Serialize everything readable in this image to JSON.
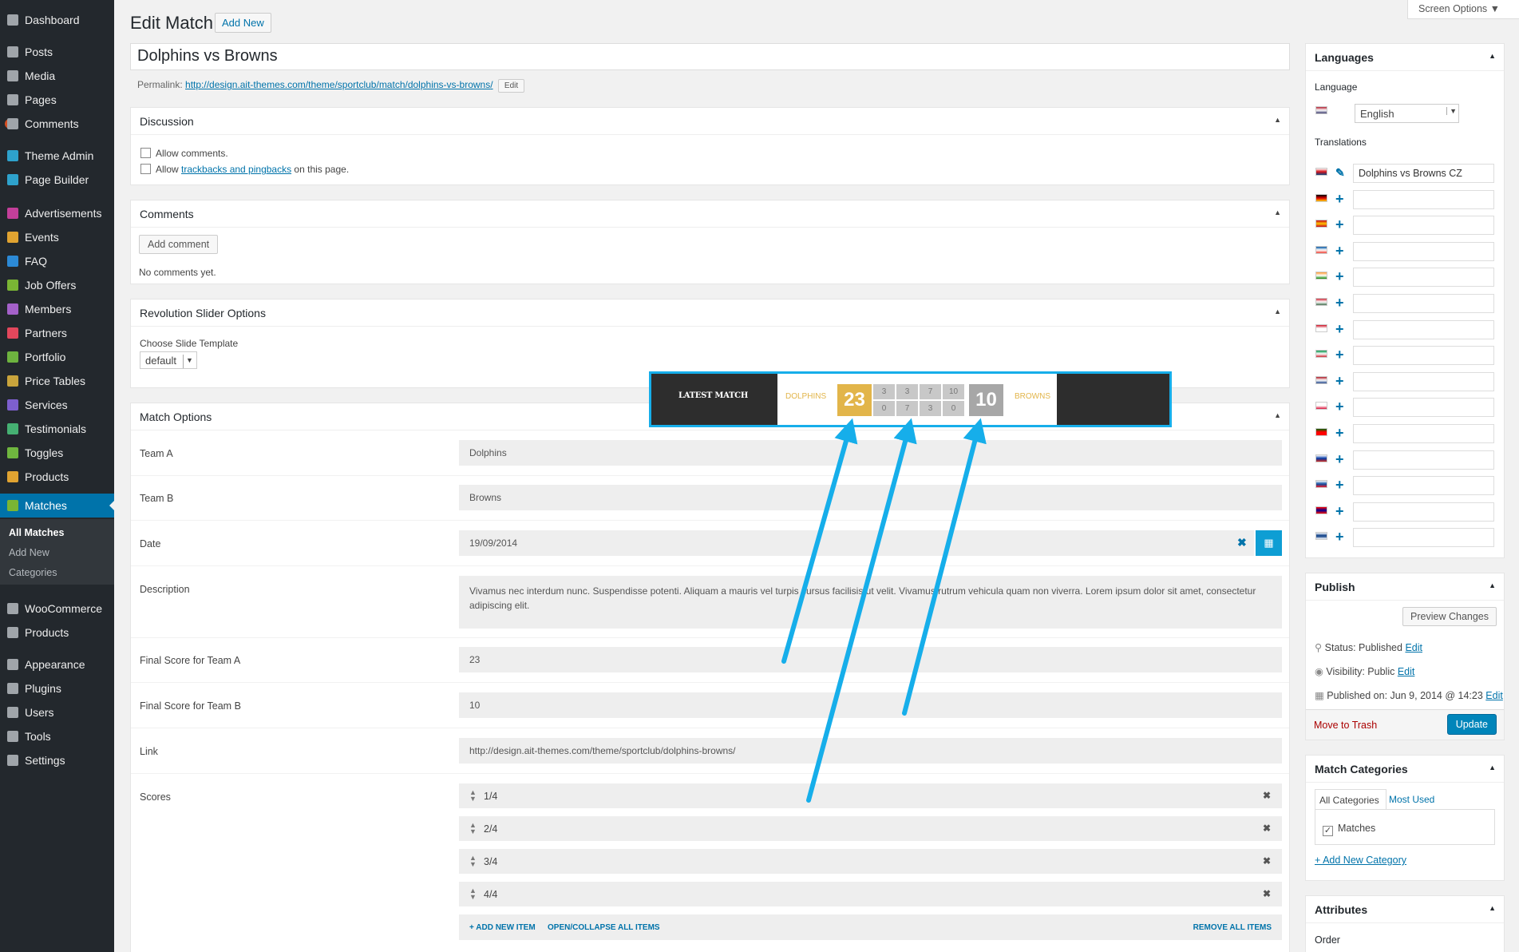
{
  "sidebar": {
    "items": [
      {
        "label": "Dashboard",
        "icon": "dashboard-icon",
        "color": "#a0a5aa"
      },
      {
        "label": "Posts",
        "icon": "pin-icon",
        "color": "#a0a5aa"
      },
      {
        "label": "Media",
        "icon": "media-icon",
        "color": "#a0a5aa"
      },
      {
        "label": "Pages",
        "icon": "pages-icon",
        "color": "#a0a5aa"
      },
      {
        "label": "Comments",
        "icon": "comment-icon",
        "color": "#a0a5aa",
        "badge": "2"
      },
      {
        "label": "Theme Admin",
        "icon": "theme-admin-icon",
        "color": "#2ea2cc"
      },
      {
        "label": "Page Builder",
        "icon": "page-builder-icon",
        "color": "#2ea2cc"
      },
      {
        "label": "Advertisements",
        "icon": "advertisements-icon",
        "color": "#c33f9a"
      },
      {
        "label": "Events",
        "icon": "events-icon",
        "color": "#e0a331"
      },
      {
        "label": "FAQ",
        "icon": "faq-icon",
        "color": "#2c8ad6"
      },
      {
        "label": "Job Offers",
        "icon": "job-offers-icon",
        "color": "#7ab534"
      },
      {
        "label": "Members",
        "icon": "members-icon",
        "color": "#a461c9"
      },
      {
        "label": "Partners",
        "icon": "partners-icon",
        "color": "#e2475c"
      },
      {
        "label": "Portfolio",
        "icon": "portfolio-icon",
        "color": "#6db33f"
      },
      {
        "label": "Price Tables",
        "icon": "price-tables-icon",
        "color": "#c9a43c"
      },
      {
        "label": "Services",
        "icon": "services-icon",
        "color": "#7d5fce"
      },
      {
        "label": "Testimonials",
        "icon": "testimonials-icon",
        "color": "#45b072"
      },
      {
        "label": "Toggles",
        "icon": "toggles-icon",
        "color": "#6fb63f"
      },
      {
        "label": "Products",
        "icon": "products-icon",
        "color": "#e0a331"
      },
      {
        "label": "Matches",
        "icon": "matches-icon",
        "color": "#7ab534",
        "current": true
      },
      {
        "label": "WooCommerce",
        "icon": "woocommerce-icon",
        "color": "#a0a5aa"
      },
      {
        "label": "Products",
        "icon": "box-icon",
        "color": "#a0a5aa"
      },
      {
        "label": "Appearance",
        "icon": "appearance-icon",
        "color": "#a0a5aa"
      },
      {
        "label": "Plugins",
        "icon": "plugins-icon",
        "color": "#a0a5aa"
      },
      {
        "label": "Users",
        "icon": "users-icon",
        "color": "#a0a5aa"
      },
      {
        "label": "Tools",
        "icon": "tools-icon",
        "color": "#a0a5aa"
      },
      {
        "label": "Settings",
        "icon": "settings-icon",
        "color": "#a0a5aa"
      }
    ],
    "submenu": [
      "All Matches",
      "Add New",
      "Categories"
    ]
  },
  "header": {
    "title": "Edit Match",
    "add_new": "Add New",
    "screen_options": "Screen Options ▼"
  },
  "post": {
    "title": "Dolphins vs Browns",
    "permalink_label": "Permalink:",
    "permalink_base": "http://design.ait-themes.com/theme/sportclub/match/",
    "permalink_slug": "dolphins-vs-browns",
    "permalink_trail": "/",
    "edit": "Edit"
  },
  "discussion": {
    "title": "Discussion",
    "allow_comments": "Allow comments.",
    "allow_pre": "Allow ",
    "allow_link": "trackbacks and pingbacks",
    "allow_post": " on this page."
  },
  "comments": {
    "title": "Comments",
    "add": "Add comment",
    "none": "No comments yet."
  },
  "slider": {
    "title": "Revolution Slider Options",
    "choose": "Choose Slide Template",
    "value": "default"
  },
  "match": {
    "title": "Match Options",
    "team_a_label": "Team A",
    "team_a": "Dolphins",
    "team_b_label": "Team B",
    "team_b": "Browns",
    "date_label": "Date",
    "date": "19/09/2014",
    "desc_label": "Description",
    "desc": "Vivamus nec interdum nunc. Suspendisse potenti. Aliquam a mauris vel turpis cursus facilisis ut velit. Vivamus rutrum vehicula quam non viverra. Lorem ipsum dolor sit amet, consectetur adipiscing elit.",
    "score_a_label": "Final Score for Team A",
    "score_a": "23",
    "score_b_label": "Final Score for Team B",
    "score_b": "10",
    "link_label": "Link",
    "link": "http://design.ait-themes.com/theme/sportclub/dolphins-browns/",
    "scores_label": "Scores",
    "scores": [
      "1/4",
      "2/4",
      "3/4",
      "4/4"
    ],
    "add_item": "+ ADD NEW ITEM",
    "toggle_items": "OPEN/COLLAPSE ALL ITEMS",
    "remove_items": "REMOVE ALL ITEMS"
  },
  "languages": {
    "title": "Languages",
    "language_label": "Language",
    "language": "English",
    "translations_label": "Translations",
    "rows": [
      {
        "flag": "cz-flag",
        "colors": [
          "#fff",
          "#d7141a",
          "#11457e"
        ],
        "value": "Dolphins vs Browns CZ",
        "action": "pencil-icon"
      },
      {
        "flag": "de-flag",
        "colors": [
          "#000",
          "#dd0000",
          "#ffce00"
        ],
        "value": "",
        "action": "plus-icon"
      },
      {
        "flag": "es-flag",
        "colors": [
          "#c60b1e",
          "#ffc400",
          "#c60b1e"
        ],
        "value": "",
        "action": "plus-icon"
      },
      {
        "flag": "fr-flag",
        "colors": [
          "#0055a4",
          "#fff",
          "#ef4135"
        ],
        "value": "",
        "action": "plus-icon"
      },
      {
        "flag": "in-flag",
        "colors": [
          "#ff9933",
          "#fff",
          "#138808"
        ],
        "value": "",
        "action": "plus-icon"
      },
      {
        "flag": "hu-flag",
        "colors": [
          "#ce2939",
          "#fff",
          "#477050"
        ],
        "value": "",
        "action": "plus-icon"
      },
      {
        "flag": "id-flag",
        "colors": [
          "#ce1126",
          "#fff",
          "#fff"
        ],
        "value": "",
        "action": "plus-icon"
      },
      {
        "flag": "it-flag",
        "colors": [
          "#009246",
          "#fff",
          "#ce2b37"
        ],
        "value": "",
        "action": "plus-icon"
      },
      {
        "flag": "nl-flag",
        "colors": [
          "#ae1c28",
          "#fff",
          "#21468b"
        ],
        "value": "",
        "action": "plus-icon"
      },
      {
        "flag": "pl-flag",
        "colors": [
          "#fff",
          "#fff",
          "#dc143c"
        ],
        "value": "",
        "action": "plus-icon"
      },
      {
        "flag": "pt-flag",
        "colors": [
          "#006600",
          "#ff0000",
          "#ff0000"
        ],
        "value": "",
        "action": "plus-icon"
      },
      {
        "flag": "ru-flag",
        "colors": [
          "#fff",
          "#0039a6",
          "#d52b1e"
        ],
        "value": "",
        "action": "plus-icon"
      },
      {
        "flag": "sk-flag",
        "colors": [
          "#fff",
          "#0b4ea2",
          "#ee1c25"
        ],
        "value": "",
        "action": "plus-icon"
      },
      {
        "flag": "tw-flag",
        "colors": [
          "#fe0000",
          "#000095",
          "#fe0000"
        ],
        "value": "",
        "action": "plus-icon"
      },
      {
        "flag": "fi-flag",
        "colors": [
          "#fff",
          "#003580",
          "#fff"
        ],
        "value": "",
        "action": "plus-icon"
      }
    ]
  },
  "publish": {
    "title": "Publish",
    "preview": "Preview Changes",
    "status_label": "Status:",
    "status": "Published",
    "visibility_label": "Visibility:",
    "visibility": "Public",
    "published_label": "Published on:",
    "published": "Jun 9, 2014 @ 14:23",
    "edit": "Edit",
    "trash": "Move to Trash",
    "update": "Update"
  },
  "categories": {
    "title": "Match Categories",
    "tab_all": "All Categories",
    "tab_used": "Most Used",
    "item": "Matches",
    "add": "+ Add New Category"
  },
  "attributes": {
    "title": "Attributes",
    "order": "Order"
  },
  "latest_match": {
    "label": "LATEST MATCH",
    "team_a": "DOLPHINS",
    "score_a": "23",
    "team_b": "BROWNS",
    "score_b": "10",
    "quarters_a": [
      "3",
      "3",
      "7",
      "10"
    ],
    "quarters_b": [
      "0",
      "7",
      "3",
      "0"
    ],
    "accent": "#e2b54a",
    "gray": "#a7a7a7",
    "arrow": "#16aeea"
  }
}
